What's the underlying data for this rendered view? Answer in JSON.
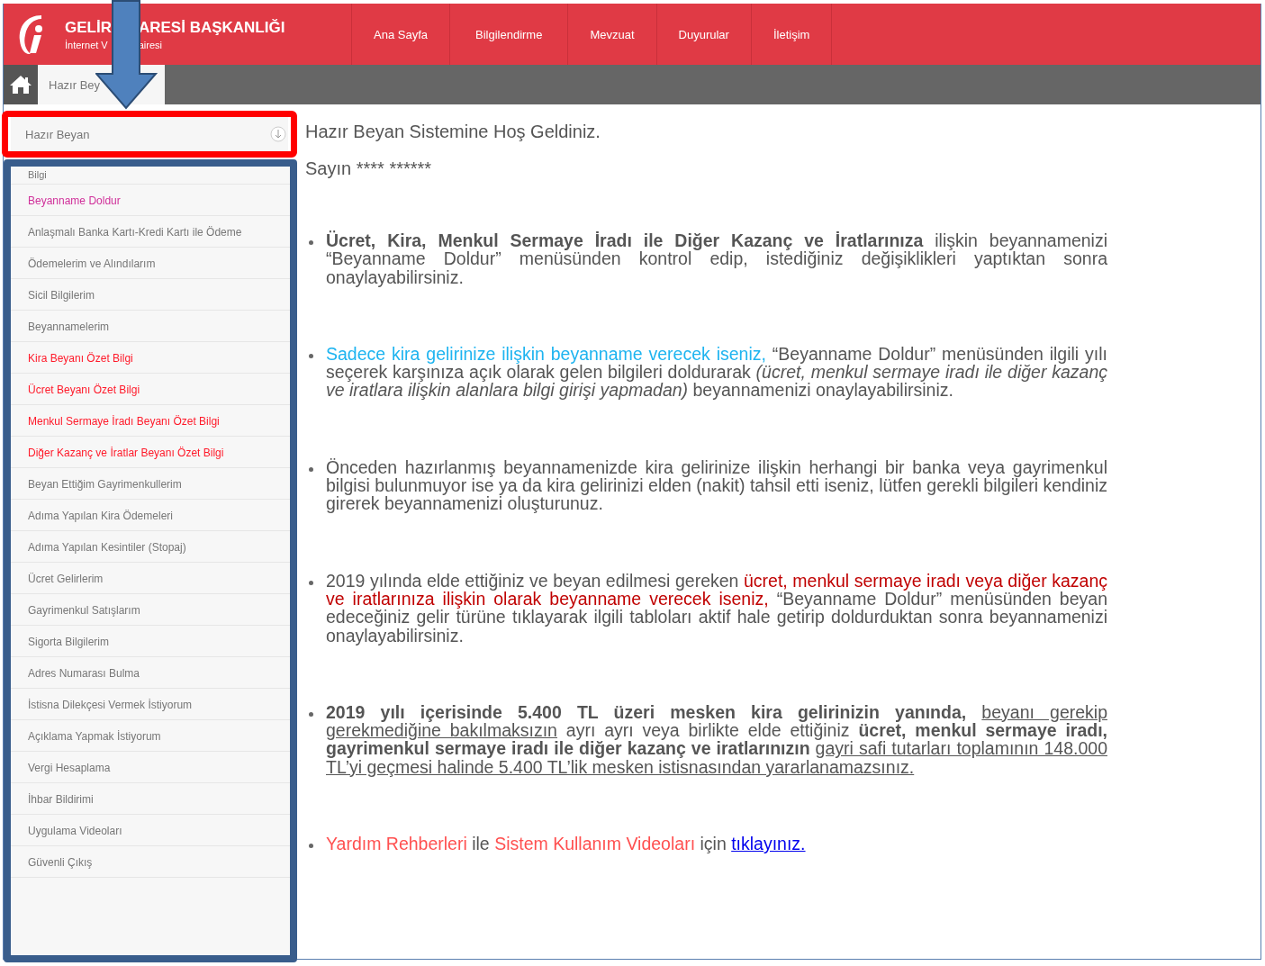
{
  "header": {
    "title_parts": [
      "GELİR",
      "ARESİ BAŞKANLIĞI"
    ],
    "subtitle_parts": [
      "İnternet V",
      "airesi"
    ],
    "nav": [
      {
        "label": "Ana Sayfa"
      },
      {
        "label": "Bilgilendirme"
      },
      {
        "label": "Mevzuat"
      },
      {
        "label": "Duyurular"
      },
      {
        "label": "İletişim"
      }
    ]
  },
  "breadcrumb": {
    "tab": "Hazır Bey"
  },
  "sidebar": {
    "section": {
      "title": "Hazır Beyan",
      "expanded": true
    },
    "items": [
      {
        "label": "Bilgi",
        "color": "#777777"
      },
      {
        "label": "Beyanname Doldur",
        "color": "#d0309a"
      },
      {
        "label": "Anlaşmalı Banka Kartı-Kredi Kartı ile Ödeme",
        "color": "#777777"
      },
      {
        "label": "Ödemelerim ve Alındılarım",
        "color": "#777777"
      },
      {
        "label": "Sicil Bilgilerim",
        "color": "#777777"
      },
      {
        "label": "Beyannamelerim",
        "color": "#777777"
      },
      {
        "label": "Kira Beyanı Özet Bilgi",
        "color": "#ff1a2a"
      },
      {
        "label": "Ücret Beyanı Özet Bilgi",
        "color": "#ff1a2a"
      },
      {
        "label": "Menkul Sermaye İradı Beyanı Özet Bilgi",
        "color": "#ff1a2a"
      },
      {
        "label": "Diğer Kazanç ve İratlar Beyanı Özet Bilgi",
        "color": "#ff1a2a"
      },
      {
        "label": "Beyan Ettiğim Gayrimenkullerim",
        "color": "#777777"
      },
      {
        "label": "Adıma Yapılan Kira Ödemeleri",
        "color": "#777777"
      },
      {
        "label": "Adıma Yapılan Kesintiler (Stopaj)",
        "color": "#777777"
      },
      {
        "label": "Ücret Gelirlerim",
        "color": "#777777"
      },
      {
        "label": "Gayrimenkul Satışlarım",
        "color": "#777777"
      },
      {
        "label": "Sigorta Bilgilerim",
        "color": "#777777"
      },
      {
        "label": "Adres Numarası Bulma",
        "color": "#777777"
      },
      {
        "label": "İstisna Dilekçesi Vermek İstiyorum",
        "color": "#777777"
      },
      {
        "label": "Açıklama Yapmak İstiyorum",
        "color": "#777777"
      },
      {
        "label": "Vergi Hesaplama",
        "color": "#777777"
      },
      {
        "label": "İhbar Bildirimi",
        "color": "#777777"
      },
      {
        "label": "Uygulama Videoları",
        "color": "#777777"
      },
      {
        "label": "Güvenli Çıkış",
        "color": "#777777"
      }
    ]
  },
  "content": {
    "heading": "Hazır Beyan Sistemine Hoş Geldiniz.",
    "greeting": "Sayın **** ******",
    "bullets": [
      [
        {
          "kind": "bold",
          "text": "Ücret, Kira, Menkul Sermaye İradı ile Diğer Kazanç ve İratlarınıza"
        },
        {
          "kind": "plain",
          "text": " ilişkin beyannamenizi “Beyanname Doldur” menüsünden kontrol edip, istediğiniz değişiklikleri yaptıktan sonra onaylayabilirsiniz."
        }
      ],
      [
        {
          "kind": "cyan",
          "text": "Sadece kira gelirinize ilişkin beyanname verecek iseniz,"
        },
        {
          "kind": "plain",
          "text": " “Beyanname Doldur” menüsünden ilgili yılı seçerek karşınıza açık olarak gelen bilgileri doldurarak "
        },
        {
          "kind": "italic",
          "text": "(ücret, menkul sermaye iradı ile diğer kazanç ve iratlara ilişkin alanlara bilgi girişi yapmadan)"
        },
        {
          "kind": "plain",
          "text": " beyannamenizi onaylayabilirsiniz."
        }
      ],
      [
        {
          "kind": "plain",
          "text": "Önceden hazırlanmış beyannamenizde kira gelirinize ilişkin herhangi bir banka veya gayrimenkul bilgisi bulunmuyor ise ya da kira gelirinizi elden (nakit) tahsil etti iseniz, lütfen gerekli bilgileri kendiniz girerek beyannamenizi oluşturunuz."
        }
      ],
      [
        {
          "kind": "plain",
          "text": "2019 yılında elde ettiğiniz ve beyan edilmesi gereken "
        },
        {
          "kind": "red",
          "text": "ücret, menkul sermaye iradı veya diğer kazanç ve iratlarınıza ilişkin olarak beyanname verecek iseniz,"
        },
        {
          "kind": "plain",
          "text": " “Beyanname Doldur” menüsünden beyan edeceğiniz gelir türüne tıklayarak ilgili tabloları aktif hale getirip doldurduktan sonra beyannamenizi onaylayabilirsiniz."
        }
      ],
      [
        {
          "kind": "bold",
          "text": "2019 yılı içerisinde 5.400 TL üzeri mesken kira gelirinizin yanında, "
        },
        {
          "kind": "underline",
          "text": "beyanı gerekip gerekmediğine bakılmaksızın"
        },
        {
          "kind": "plain",
          "text": " ayrı ayrı veya birlikte elde ettiğiniz "
        },
        {
          "kind": "bold",
          "text": "ücret, menkul sermaye iradı, gayrimenkul sermaye iradı ile diğer kazanç ve iratlarınızın "
        },
        {
          "kind": "underline",
          "text": "gayri safi tutarları toplamının 148.000 TL’yi geçmesi halinde 5.400 TL’lik mesken istisnasından yararlanamazsınız."
        }
      ],
      [
        {
          "kind": "salmon",
          "text": "Yardım Rehberleri"
        },
        {
          "kind": "plain",
          "text": " ile "
        },
        {
          "kind": "salmon",
          "text": "Sistem Kullanım Videoları"
        },
        {
          "kind": "plain",
          "text": " için "
        },
        {
          "kind": "link",
          "text": "tıklayınız."
        }
      ]
    ]
  }
}
